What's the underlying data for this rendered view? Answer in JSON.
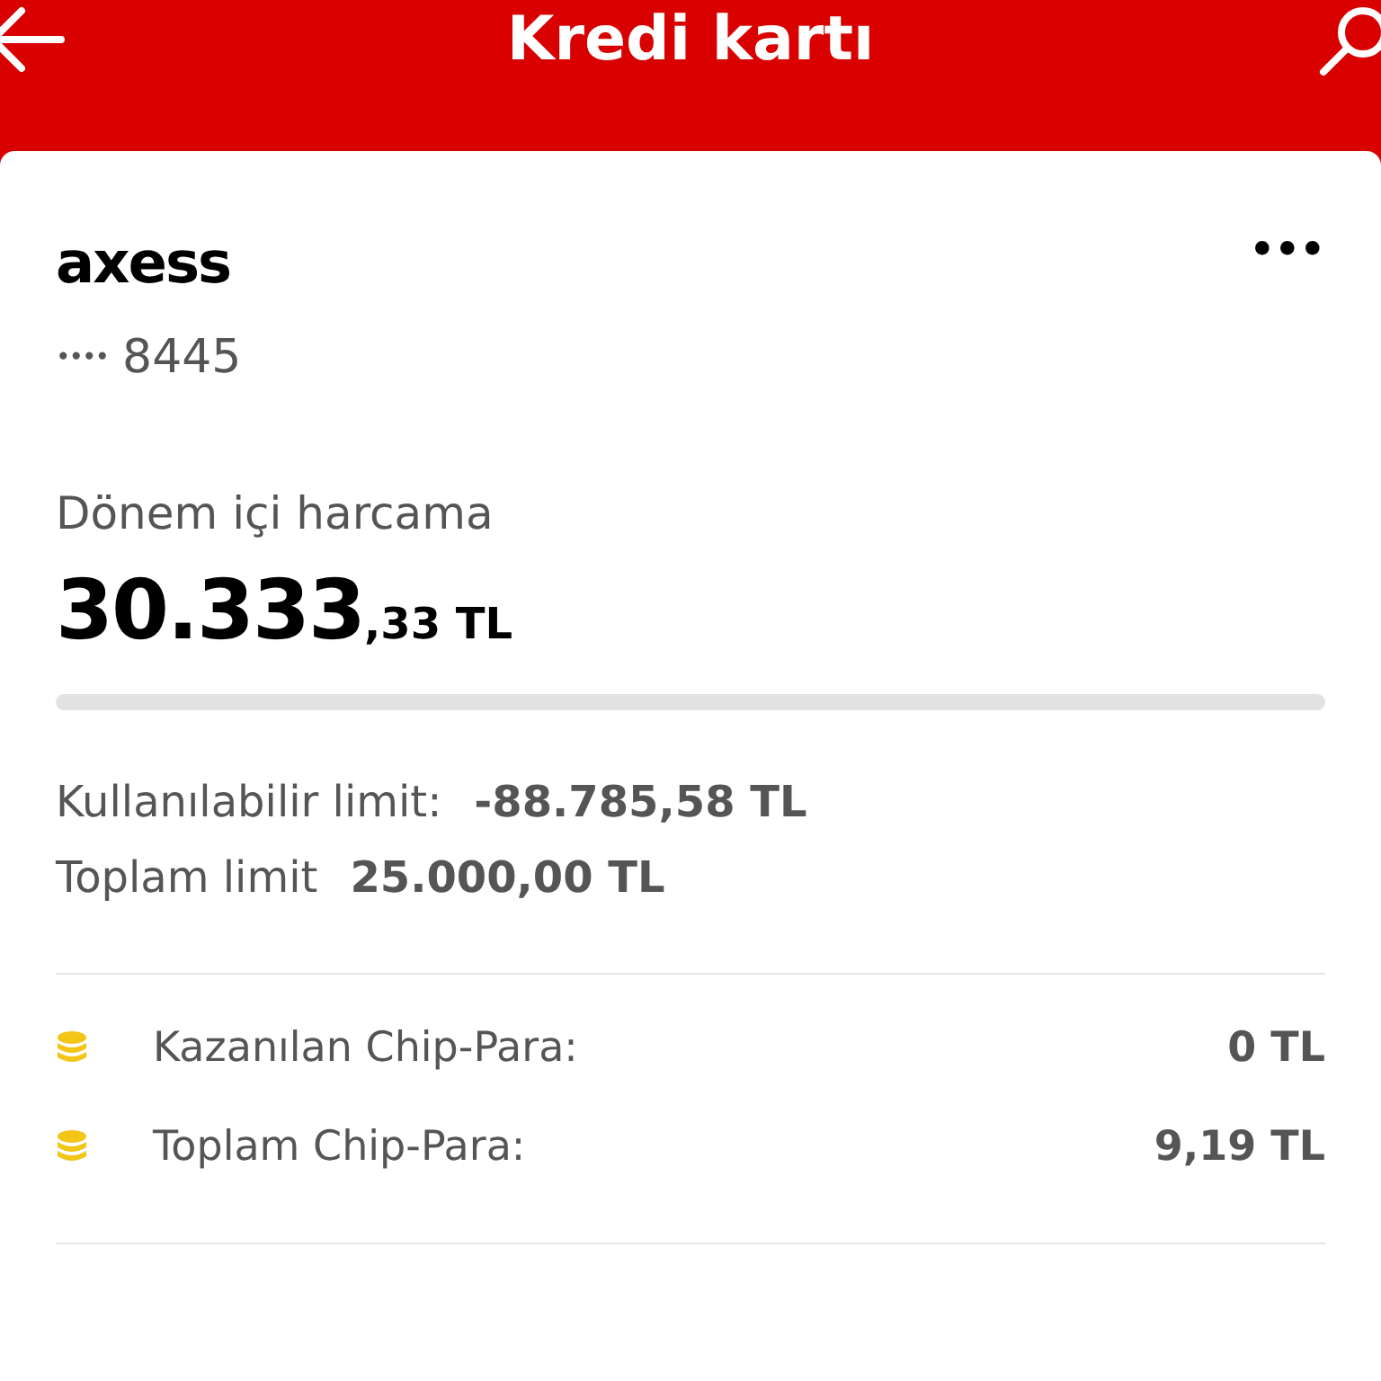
{
  "header": {
    "title": "Kredi kartı"
  },
  "card": {
    "brand": "axess",
    "masked_dots": "••••",
    "last_digits": "8445",
    "more": "•••"
  },
  "spending": {
    "label": "Dönem içi harcama",
    "amount_main": "30.333",
    "amount_fraction": ",33 TL"
  },
  "limits": [
    {
      "label": "Kullanılabilir limit:",
      "value": "-88.785,58 TL"
    },
    {
      "label": "Toplam limit",
      "value": "25.000,00 TL"
    }
  ],
  "chip_para": [
    {
      "label": "Kazanılan Chip-Para:",
      "value": "0 TL"
    },
    {
      "label": "Toplam Chip-Para:",
      "value": "9,19 TL"
    }
  ]
}
